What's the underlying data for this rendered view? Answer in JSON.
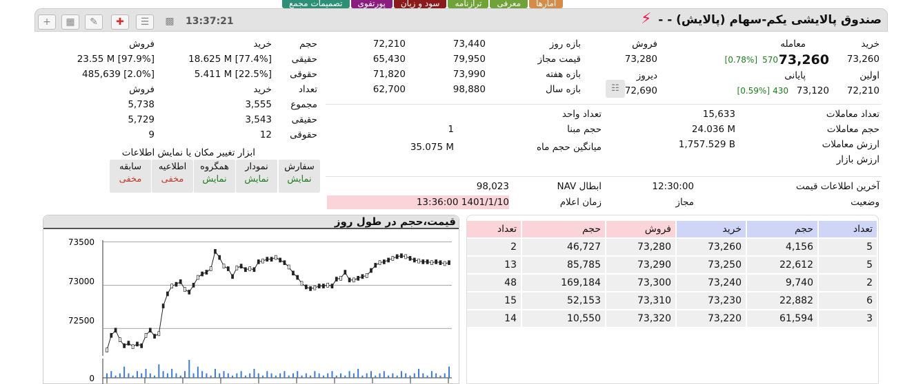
{
  "tabs": [
    {
      "label": "آمارها",
      "color": "#d58c4a"
    },
    {
      "label": "معرفی",
      "color": "#6fa33a"
    },
    {
      "label": "ترازنامه",
      "color": "#6fa33a"
    },
    {
      "label": "سود و زیان",
      "color": "#8b1b1b"
    },
    {
      "label": "پورتفوی",
      "color": "#8a1d7f"
    },
    {
      "label": "تصمیمات مجمع",
      "color": "#2e8f77"
    }
  ],
  "header": {
    "title": "صندوق پالایشی یکم-سهام (پالایش) - -",
    "time": "13:37:21"
  },
  "prices": {
    "buy_label": "خرید",
    "buy_value": "73,260",
    "trade_label": "معامله",
    "trade_value": "73,260",
    "trade_change": "570",
    "trade_pct": "[0.78%]",
    "sell_label": "فروش",
    "sell_value": "73,280",
    "first_label": "اولین",
    "first_value": "72,210",
    "last_label": "پایانی",
    "last_value": "73,120",
    "last_change": "430",
    "last_pct": "[0.59%]",
    "yesterday_label": "دیروز",
    "yesterday_value": "72,690"
  },
  "ranges": {
    "day_label": "بازه روز",
    "day_high": "73,440",
    "day_low": "72,210",
    "allowed_label": "قیمت مجاز",
    "allowed_high": "79,950",
    "allowed_low": "65,430",
    "week_label": "بازه هفته",
    "week_high": "73,990",
    "week_low": "71,820",
    "year_label": "بازه سال",
    "year_high": "98,880",
    "year_low": "62,700"
  },
  "client": {
    "h_volume": "حجم",
    "h_buy": "خرید",
    "h_sell": "فروش",
    "real_label": "حقیقی",
    "real_buy": "18.625 M [77.4%]",
    "real_sell": "23.55 M [97.9%]",
    "legal_label": "حقوقی",
    "legal_buy": "5.411 M [22.5%]",
    "legal_sell": "485,639 [2.0%]",
    "h_count": "تعداد",
    "h_buy2": "خرید",
    "h_sell2": "فروش",
    "total_label": "مجموع",
    "total_buy": "3,555",
    "total_sell": "5,738",
    "real2_label": "حقیقی",
    "real2_buy": "3,543",
    "real2_sell": "5,729",
    "legal2_label": "حقوقی",
    "legal2_buy": "12",
    "legal2_sell": "9"
  },
  "stats": {
    "trades_count_label": "تعداد معاملات",
    "trades_count": "15,633",
    "trades_volume_label": "حجم معاملات",
    "trades_volume": "24.036 M",
    "trades_value_label": "ارزش معاملات",
    "trades_value": "1,757.529 B",
    "market_value_label": "ارزش بازار",
    "market_value": "",
    "unit_count_label": "تعداد واحد",
    "unit_count": "",
    "base_volume_label": "حجم مبنا",
    "base_volume": "1",
    "month_avg_label": "میانگین حجم ماه",
    "month_avg": "35.075 M"
  },
  "tools": {
    "title": "ابزار تغییر مکان یا نمایش اطلاعات",
    "buttons": [
      {
        "label": "سفارش",
        "state": "نمایش",
        "shown": true
      },
      {
        "label": "نمودار",
        "state": "نمایش",
        "shown": true
      },
      {
        "label": "همگروه",
        "state": "نمایش",
        "shown": true
      },
      {
        "label": "اطلاعیه",
        "state": "مخفی",
        "shown": false
      },
      {
        "label": "سابقه",
        "state": "مخفی",
        "shown": false
      }
    ]
  },
  "info": {
    "last_info_label": "آخرین اطلاعات قیمت",
    "last_info": "12:30:00",
    "status_label": "وضعیت",
    "status": "مجاز",
    "nav_label": "NAV ابطال",
    "nav": "98,023",
    "announce_label": "زمان اعلام",
    "announce": "13:36:00 1401/1/10"
  },
  "chart_data": {
    "type": "line",
    "title": "قیمت،حجم در طول روز",
    "ylim": [
      72200,
      73520
    ],
    "yticks": [
      "73500",
      "73000",
      "72500"
    ],
    "volume_ytick": "0",
    "values": [
      72250,
      72420,
      72480,
      72370,
      72300,
      72330,
      72290,
      72320,
      72300,
      72420,
      72480,
      72410,
      72440,
      72760,
      72900,
      72990,
      73010,
      73040,
      72950,
      72920,
      73000,
      73090,
      73130,
      73150,
      73190,
      73390,
      73320,
      73220,
      73190,
      73100,
      73200,
      73220,
      73180,
      73190,
      73180,
      73270,
      73280,
      73300,
      73300,
      73320,
      73290,
      73260,
      73210,
      73140,
      73090,
      73020,
      72980,
      72960,
      72970,
      72990,
      72990,
      73000,
      72990,
      73070,
      73080,
      73150,
      73060,
      73060,
      73080,
      73100,
      73110,
      73170,
      73230,
      73260,
      73270,
      73290,
      73310,
      73330,
      73340,
      73330,
      73310,
      73290,
      73280,
      73270,
      73270,
      73260,
      73270,
      73260,
      73250,
      73260
    ],
    "volumes": [
      2,
      3,
      1,
      2,
      5,
      2,
      1,
      3,
      2,
      4,
      2,
      1,
      6,
      3,
      2,
      4,
      2,
      1,
      3,
      8,
      2,
      5,
      3,
      2,
      1,
      4,
      2,
      3,
      2,
      1,
      2,
      3,
      1,
      2,
      4,
      2,
      1,
      3,
      2,
      1,
      2,
      3,
      1,
      2,
      3,
      1,
      2,
      1,
      3,
      2,
      1,
      2,
      3,
      1,
      2,
      1,
      3,
      2,
      4,
      1,
      2,
      3,
      1,
      2,
      3,
      1,
      2,
      1,
      3,
      2,
      1,
      2,
      4,
      2,
      1,
      3,
      2,
      1,
      2,
      5
    ]
  },
  "orderbook": {
    "headers": [
      "تعداد",
      "حجم",
      "خرید",
      "فروش",
      "حجم",
      "تعداد"
    ],
    "rows": [
      [
        "5",
        "4,156",
        "73,260",
        "73,280",
        "46,727",
        "2"
      ],
      [
        "5",
        "22,612",
        "73,250",
        "73,290",
        "85,785",
        "13"
      ],
      [
        "2",
        "9,740",
        "73,240",
        "73,300",
        "169,184",
        "48"
      ],
      [
        "6",
        "22,882",
        "73,230",
        "73,310",
        "52,153",
        "15"
      ],
      [
        "3",
        "61,594",
        "73,220",
        "73,320",
        "10,550",
        "14"
      ]
    ]
  }
}
